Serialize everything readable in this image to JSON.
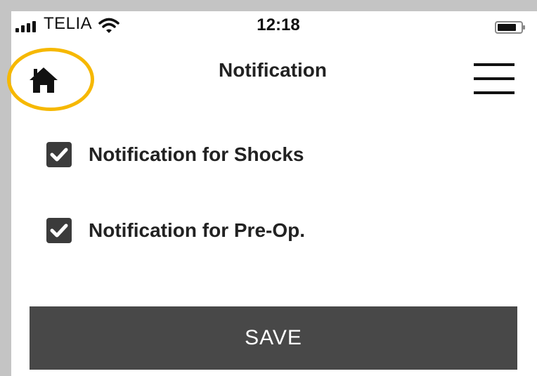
{
  "status_bar": {
    "carrier": "TELIA",
    "time": "12:18"
  },
  "header": {
    "title": "Notification",
    "home_icon": "home-icon",
    "menu_icon": "hamburger-menu-icon",
    "highlight_color": "#f6b800"
  },
  "options": [
    {
      "label": "Notification for Shocks",
      "checked": true
    },
    {
      "label": "Notification for Pre-Op.",
      "checked": true
    }
  ],
  "save_button": {
    "label": "SAVE",
    "color": "#484848"
  }
}
